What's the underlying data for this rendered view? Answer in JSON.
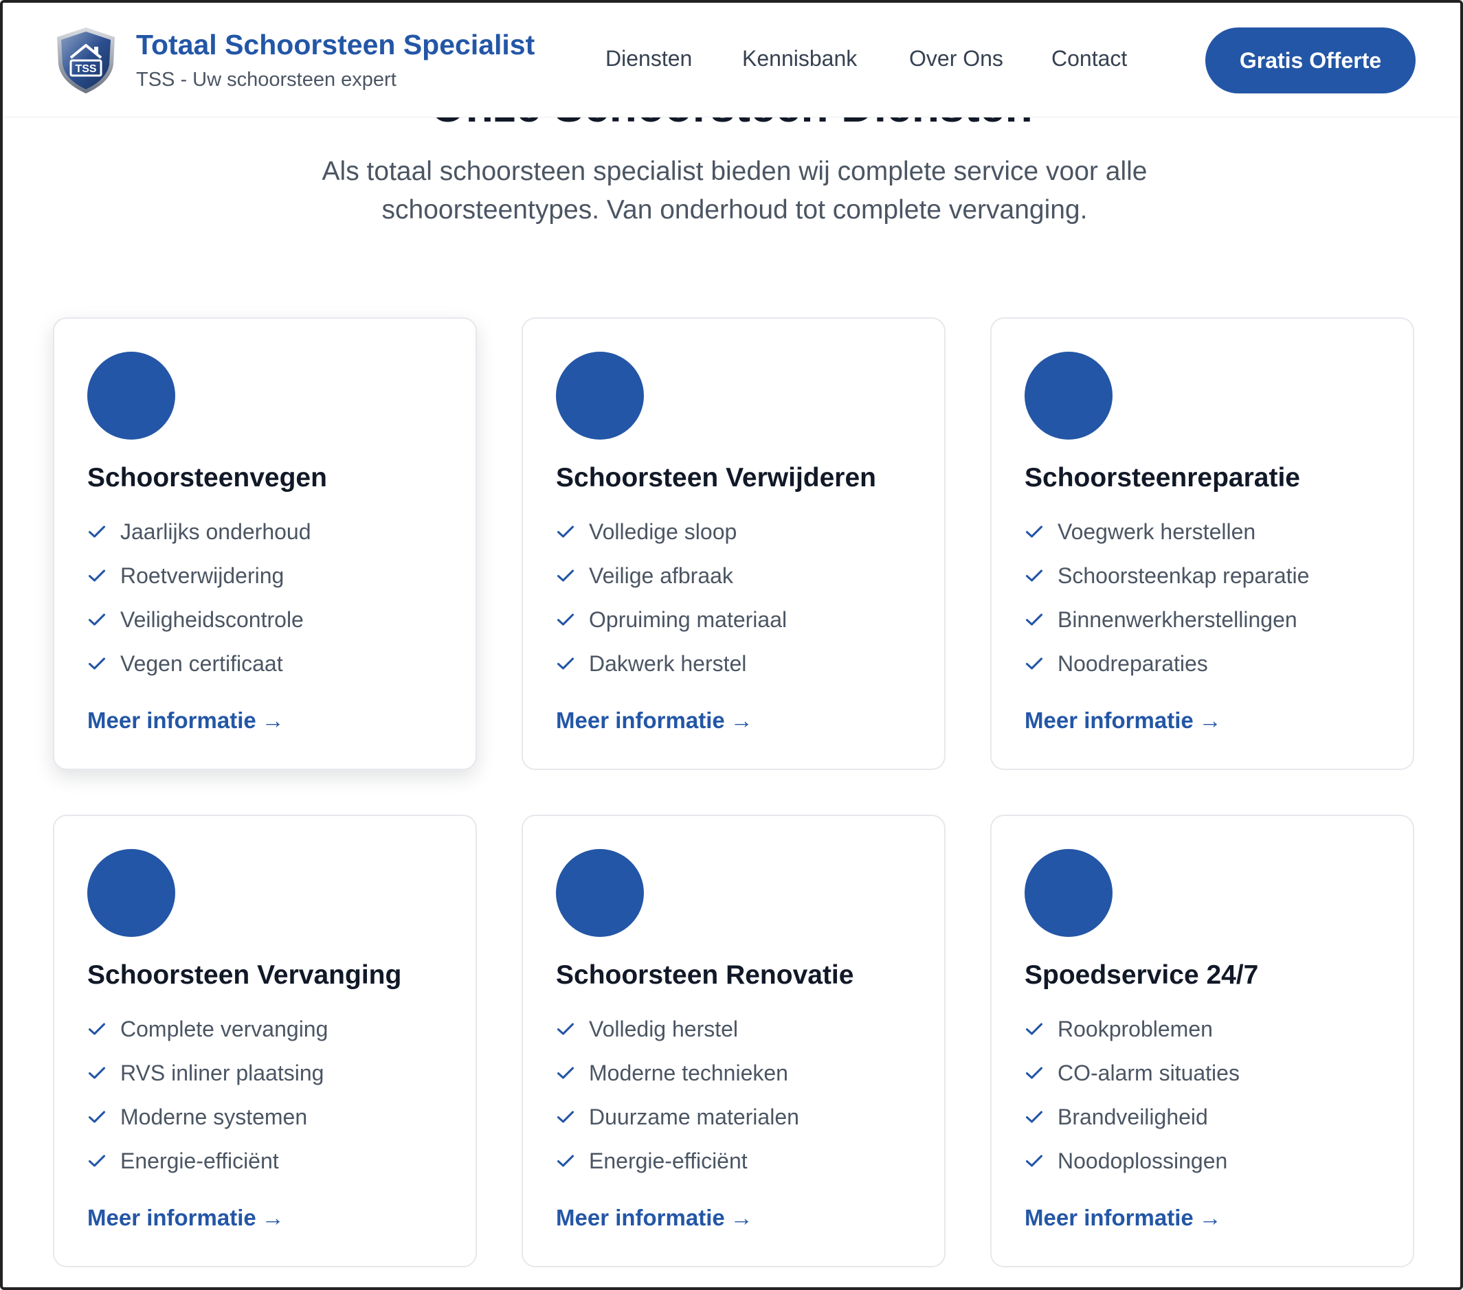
{
  "header": {
    "brand_name": "Totaal Schoorsteen Specialist",
    "brand_tagline": "TSS - Uw schoorsteen expert",
    "logo_text": "TSS",
    "nav": [
      "Diensten",
      "Kennisbank",
      "Over Ons",
      "Contact"
    ],
    "cta_label": "Gratis Offerte"
  },
  "intro": {
    "title": "Onze Schoorsteen Diensten",
    "text": "Als totaal schoorsteen specialist bieden wij complete service voor alle schoorsteentypes. Van onderhoud tot complete vervanging."
  },
  "services": [
    {
      "title": "Schoorsteenvegen",
      "features": [
        "Jaarlijks onderhoud",
        "Roetverwijdering",
        "Veiligheidscontrole",
        "Vegen certificaat"
      ],
      "link": "Meer informatie",
      "link_arrow": "→"
    },
    {
      "title": "Schoorsteen Verwijderen",
      "features": [
        "Volledige sloop",
        "Veilige afbraak",
        "Opruiming materiaal",
        "Dakwerk herstel"
      ],
      "link": "Meer informatie",
      "link_arrow": "→"
    },
    {
      "title": "Schoorsteenreparatie",
      "features": [
        "Voegwerk herstellen",
        "Schoorsteenkap reparatie",
        "Binnenwerkherstellingen",
        "Noodreparaties"
      ],
      "link": "Meer informatie",
      "link_arrow": "→"
    },
    {
      "title": "Schoorsteen Vervanging",
      "features": [
        "Complete vervanging",
        "RVS inliner plaatsing",
        "Moderne systemen",
        "Energie-efficiënt"
      ],
      "link": "Meer informatie",
      "link_arrow": "→"
    },
    {
      "title": "Schoorsteen Renovatie",
      "features": [
        "Volledig herstel",
        "Moderne technieken",
        "Duurzame materialen",
        "Energie-efficiënt"
      ],
      "link": "Meer informatie",
      "link_arrow": "→"
    },
    {
      "title": "Spoedservice 24/7",
      "features": [
        "Rookproblemen",
        "CO-alarm situaties",
        "Brandveiligheid",
        "Noodoplossingen"
      ],
      "link": "Meer informatie",
      "link_arrow": "→"
    }
  ],
  "icons": {
    "logo": "tss-shield-house-logo",
    "service_icon": "blue-circle-icon",
    "feature_check": "check-icon",
    "link_arrow": "arrow-right-icon"
  },
  "colors": {
    "primary": "#2356a6",
    "heading": "#111827",
    "body": "#4b5563",
    "border": "#e6e8ec"
  }
}
